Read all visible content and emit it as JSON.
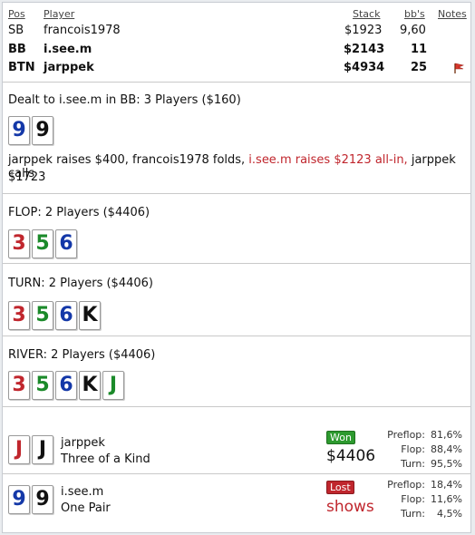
{
  "header": {
    "pos_label": "Pos",
    "player_label": "Player",
    "stack_label": "Stack",
    "bbs_label": "bb's",
    "notes_label": "Notes"
  },
  "players": [
    {
      "pos": "SB",
      "name": "francois1978",
      "stack": "$1923",
      "bbs": "9,60",
      "bold": false
    },
    {
      "pos": "BB",
      "name": "i.see.m",
      "stack": "$2143",
      "bbs": "11",
      "bold": true
    },
    {
      "pos": "BTN",
      "name": "jarppek",
      "stack": "$4934",
      "bbs": "25",
      "bold": true
    }
  ],
  "preflop": {
    "title": "Dealt to i.see.m in BB: 3 Players ($160)",
    "cards": [
      {
        "rank": "9",
        "color": "blue"
      },
      {
        "rank": "9",
        "color": "black"
      }
    ],
    "action_part1": "jarppek raises $400, francois1978 folds, ",
    "action_hero": "i.see.m raises $2123 all-in,",
    "action_part2": " jarppek calls",
    "action_line2": "$1723"
  },
  "flop": {
    "title": "FLOP: 2 Players ($4406)",
    "cards": [
      {
        "rank": "3",
        "color": "red"
      },
      {
        "rank": "5",
        "color": "green"
      },
      {
        "rank": "6",
        "color": "blue"
      }
    ]
  },
  "turn": {
    "title": "TURN: 2 Players ($4406)",
    "cards": [
      {
        "rank": "3",
        "color": "red"
      },
      {
        "rank": "5",
        "color": "green"
      },
      {
        "rank": "6",
        "color": "blue"
      },
      {
        "rank": "K",
        "color": "black"
      }
    ]
  },
  "river": {
    "title": "RIVER: 2 Players ($4406)",
    "cards": [
      {
        "rank": "3",
        "color": "red"
      },
      {
        "rank": "5",
        "color": "green"
      },
      {
        "rank": "6",
        "color": "blue"
      },
      {
        "rank": "K",
        "color": "black"
      },
      {
        "rank": "J",
        "color": "green"
      }
    ]
  },
  "results": [
    {
      "name": "jarppek",
      "hand": "Three of a Kind",
      "badge": "Won",
      "amount": "$4406",
      "cards": [
        {
          "rank": "J",
          "color": "red"
        },
        {
          "rank": "J",
          "color": "black"
        }
      ],
      "stats": [
        {
          "label": "Preflop:",
          "value": "81,6%"
        },
        {
          "label": "Flop:",
          "value": "88,4%"
        },
        {
          "label": "Turn:",
          "value": "95,5%"
        }
      ]
    },
    {
      "name": "i.see.m",
      "hand": "One Pair",
      "badge": "Lost",
      "amount": "shows",
      "cards": [
        {
          "rank": "9",
          "color": "blue"
        },
        {
          "rank": "9",
          "color": "black"
        }
      ],
      "stats": [
        {
          "label": "Preflop:",
          "value": "18,4%"
        },
        {
          "label": "Flop:",
          "value": "11,6%"
        },
        {
          "label": "Turn:",
          "value": "4,5%"
        }
      ]
    }
  ],
  "colors": {
    "red": "#c0262d",
    "blue": "#1438a8",
    "green": "#1b8a2a",
    "black": "#111111",
    "won": "#2d9a2f",
    "lost": "#c0262d"
  }
}
